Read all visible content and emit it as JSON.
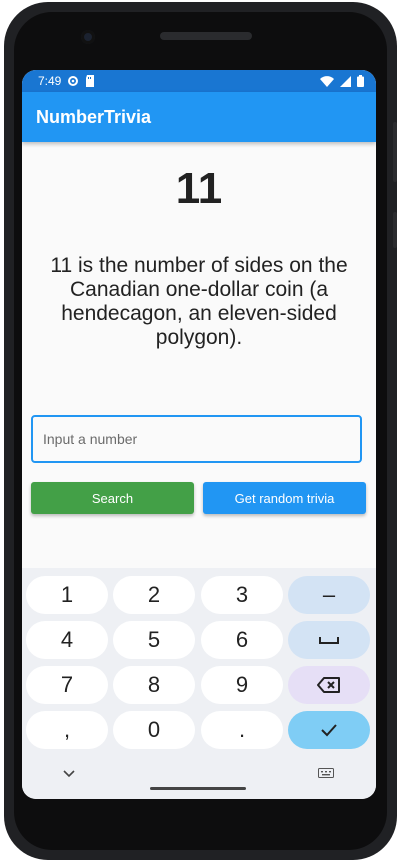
{
  "status_bar": {
    "time": "7:49"
  },
  "app_bar": {
    "title": "NumberTrivia"
  },
  "trivia": {
    "number": "11",
    "text": "11 is the number of sides on the Canadian one-dollar coin (a hendecagon, an eleven-sided polygon)."
  },
  "input": {
    "placeholder": "Input a number",
    "value": ""
  },
  "buttons": {
    "search": "Search",
    "random": "Get random trivia"
  },
  "colors": {
    "app_bar": "#2196f3",
    "status_bar": "#1976d2",
    "search_button": "#43a047",
    "random_button": "#2196f3"
  },
  "keyboard": {
    "keys": [
      "1",
      "2",
      "3",
      "–",
      "4",
      "5",
      "6",
      "space",
      "7",
      "8",
      "9",
      "backspace",
      ",",
      "0",
      ".",
      "done"
    ]
  }
}
